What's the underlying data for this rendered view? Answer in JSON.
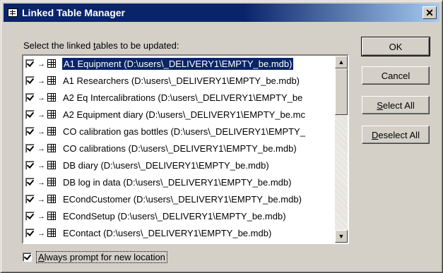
{
  "window": {
    "title": "Linked Table Manager",
    "close_glyph": "✕",
    "icon": "table-icon"
  },
  "instructions": {
    "before": "Select the linked ",
    "accel": "t",
    "after": "ables to be updated:"
  },
  "rows": [
    {
      "text": "A1 Equipment  (D:\\users\\_DELIVERY1\\EMPTY_be.mdb)",
      "checked": true,
      "selected": true
    },
    {
      "text": "A1 Researchers  (D:\\users\\_DELIVERY1\\EMPTY_be.mdb)",
      "checked": true
    },
    {
      "text": "A2 Eq Intercalibrations  (D:\\users\\_DELIVERY1\\EMPTY_be",
      "checked": true
    },
    {
      "text": "A2 Equipment diary  (D:\\users\\_DELIVERY1\\EMPTY_be.mc",
      "checked": true
    },
    {
      "text": "CO calibration gas bottles  (D:\\users\\_DELIVERY1\\EMPTY_",
      "checked": true
    },
    {
      "text": "CO calibrations  (D:\\users\\_DELIVERY1\\EMPTY_be.mdb)",
      "checked": true
    },
    {
      "text": "DB diary  (D:\\users\\_DELIVERY1\\EMPTY_be.mdb)",
      "checked": true
    },
    {
      "text": "DB log in data  (D:\\users\\_DELIVERY1\\EMPTY_be.mdb)",
      "checked": true
    },
    {
      "text": "ECondCustomer  (D:\\users\\_DELIVERY1\\EMPTY_be.mdb)",
      "checked": true
    },
    {
      "text": "ECondSetup  (D:\\users\\_DELIVERY1\\EMPTY_be.mdb)",
      "checked": true
    },
    {
      "text": "EContact  (D:\\users\\_DELIVERY1\\EMPTY_be.mdb)",
      "checked": true
    }
  ],
  "row_icons": {
    "arrow": "→",
    "table": "table-icon"
  },
  "scroll": {
    "up": "▲",
    "down": "▼"
  },
  "buttons": {
    "ok": {
      "label": "OK"
    },
    "cancel": {
      "label": "Cancel"
    },
    "select_all": {
      "accel": "S",
      "rest": "elect All"
    },
    "deselect_all": {
      "accel": "D",
      "rest": "eselect All"
    }
  },
  "always_prompt": {
    "accel": "A",
    "rest": "lways prompt for new location",
    "checked": true
  },
  "colors": {
    "titlebar": "#0a246a",
    "selection": "#0a246a",
    "face": "#d4d0c8"
  }
}
